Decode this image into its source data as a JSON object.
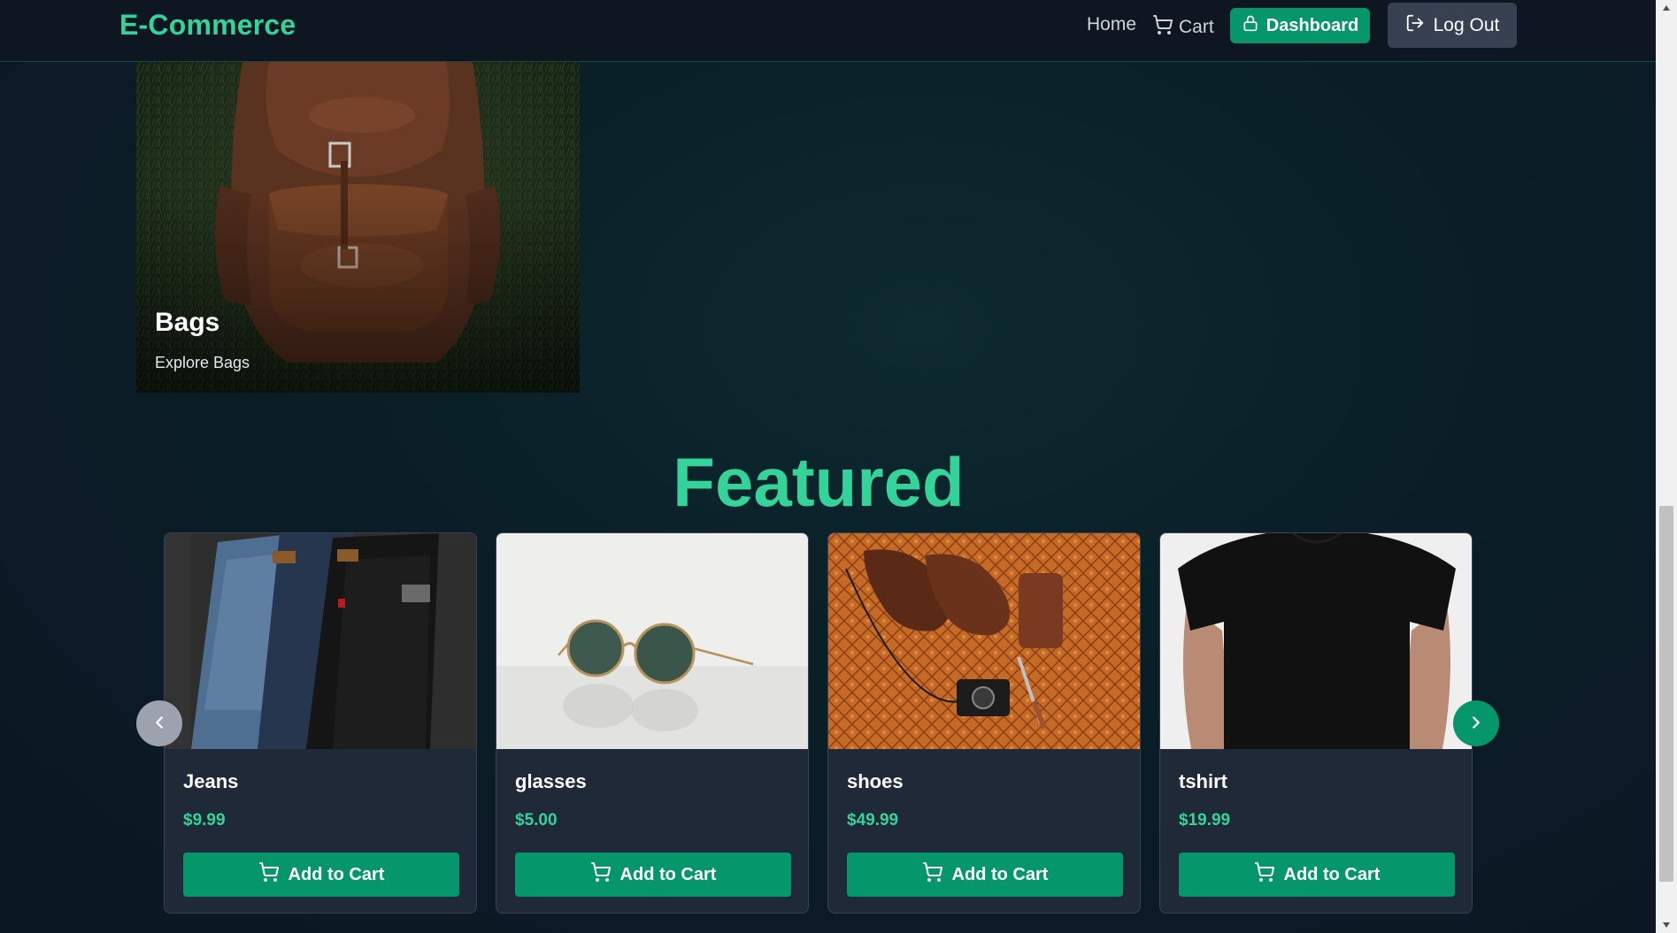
{
  "navbar": {
    "brand": "E-Commerce",
    "home_label": "Home",
    "cart_label": "Cart",
    "dashboard_label": "Dashboard",
    "logout_label": "Log Out",
    "icons": {
      "cart": "cart-icon",
      "dashboard": "lock-icon",
      "logout": "logout-icon"
    }
  },
  "category": {
    "title": "Bags",
    "link_text": "Explore Bags"
  },
  "featured": {
    "title": "Featured",
    "products": [
      {
        "name": "Jeans",
        "price": "$9.99",
        "button": "Add to Cart"
      },
      {
        "name": "glasses",
        "price": "$5.00",
        "button": "Add to Cart"
      },
      {
        "name": "shoes",
        "price": "$49.99",
        "button": "Add to Cart"
      },
      {
        "name": "tshirt",
        "price": "$19.99",
        "button": "Add to Cart"
      }
    ],
    "prev_icon": "chevron-left-icon",
    "next_icon": "chevron-right-icon"
  },
  "colors": {
    "accent": "#34d399",
    "button": "#059669",
    "card": "#1f2937",
    "background": "#0b1a26"
  }
}
